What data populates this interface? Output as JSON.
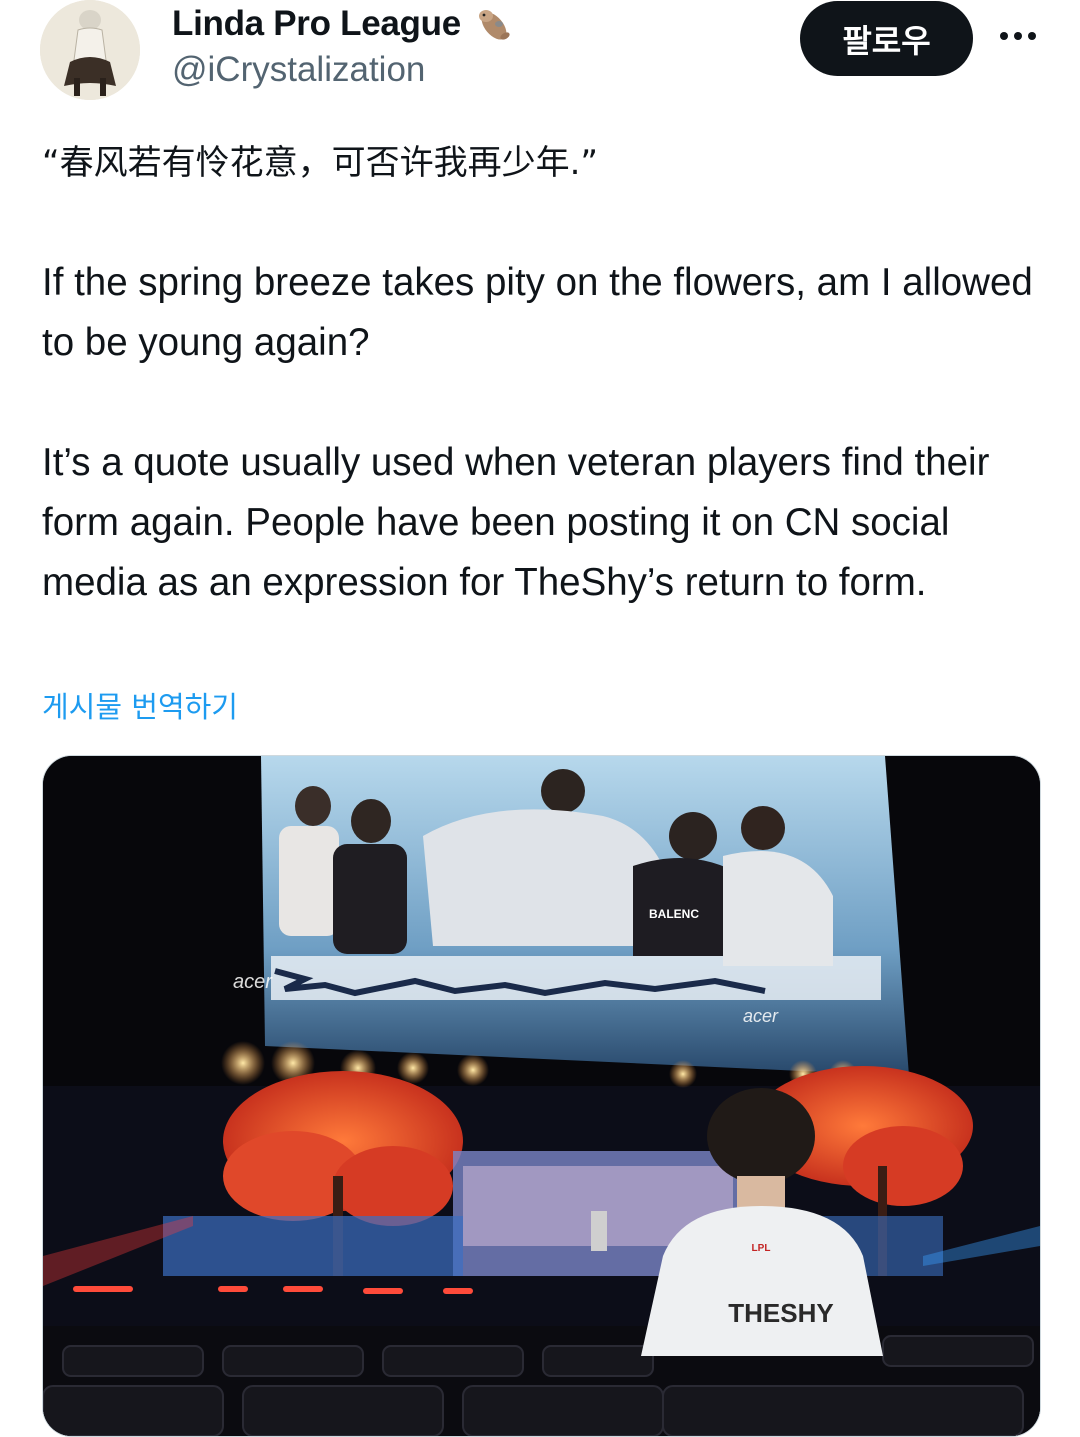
{
  "author": {
    "display_name": "Linda Pro League",
    "handle": "@iCrystalization",
    "badge_icon": "otter-emoji-icon"
  },
  "actions": {
    "follow_label": "팔로우",
    "more_icon": "more-options-icon"
  },
  "post": {
    "chinese_quote": "“春风若有怜花意，可否许我再少年.”",
    "translation": "If the spring breeze takes pity on the flowers, am I allowed to be young again?",
    "explanation": "It’s a quote usually used when veteran players find their form again. People have been posting it on CN social media as an expression for TheShy’s return to form.",
    "translate_link": "게시물 번역하기"
  },
  "media": {
    "image_icon": "photo-icon",
    "screen_logo_left": "acer",
    "screen_logo_right": "acer",
    "jersey_name": "THESHY",
    "jersey_badge": "LPL",
    "shirt_text": "BALENC"
  },
  "colors": {
    "follow_bg": "#0f1419",
    "link": "#1d9bf0",
    "handle": "#536471",
    "text": "#0f1419"
  }
}
